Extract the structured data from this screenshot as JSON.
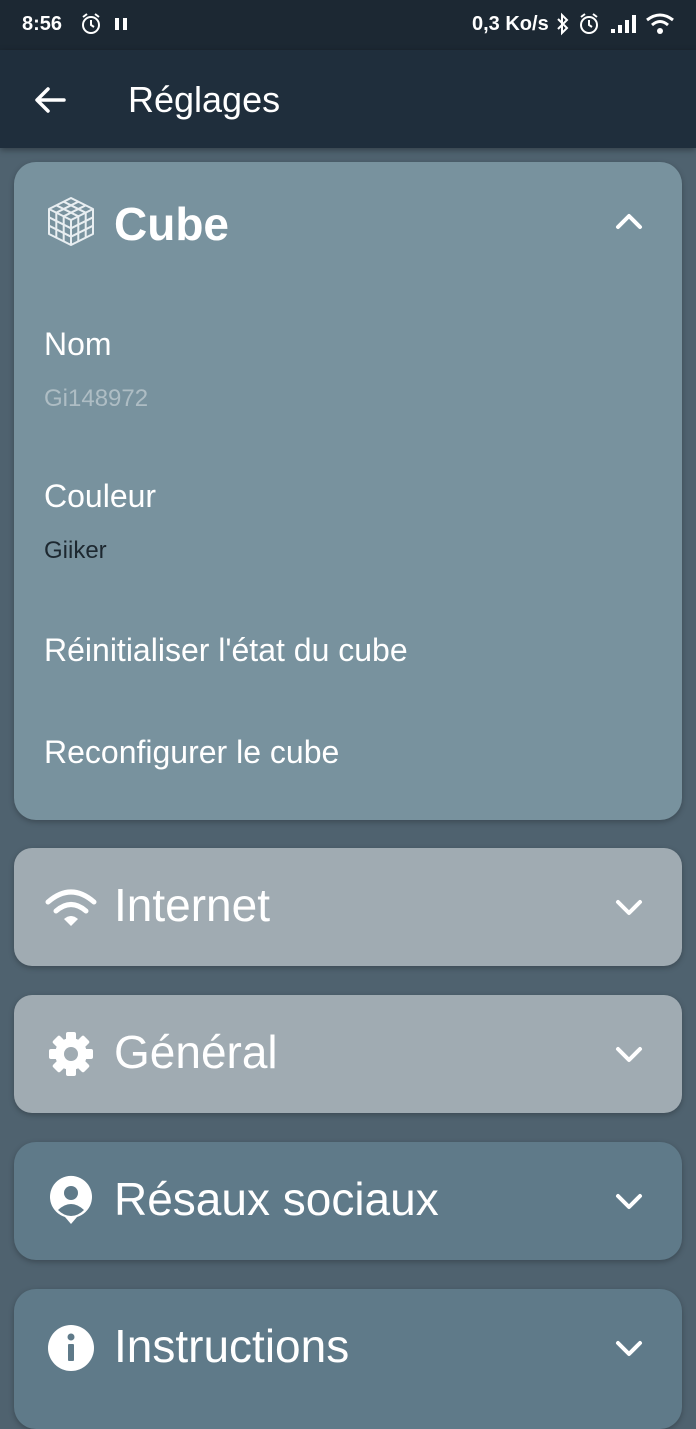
{
  "status_bar": {
    "time": "8:56",
    "speed": "0,3 Ko/s",
    "icons": [
      "alarm-icon",
      "pause-icon",
      "bluetooth-icon",
      "alarm-icon",
      "signal-icon",
      "wifi-icon"
    ]
  },
  "app_bar": {
    "title": "Réglages",
    "back_icon": "arrow-left-icon"
  },
  "sections": {
    "cube": {
      "title": "Cube",
      "icon": "cube-icon",
      "expanded": true,
      "settings": {
        "name": {
          "label": "Nom",
          "value": "Gi148972"
        },
        "color": {
          "label": "Couleur",
          "value": "Giiker"
        },
        "reset": {
          "label": "Réinitialiser l'état du cube"
        },
        "reconfigure": {
          "label": "Reconfigurer le cube"
        }
      }
    },
    "internet": {
      "title": "Internet",
      "icon": "wifi-icon",
      "expanded": false
    },
    "general": {
      "title": "Général",
      "icon": "gear-icon",
      "expanded": false
    },
    "social": {
      "title": "Résaux sociaux",
      "icon": "account-icon",
      "expanded": false
    },
    "instructions": {
      "title": "Instructions",
      "icon": "info-icon",
      "expanded": false
    }
  },
  "colors": {
    "background": "#4f626f",
    "app_bar": "#1f2e3c",
    "status_bar": "#1c2833",
    "progress_line": "#43c51a",
    "cube_card": "#78929e",
    "disabled_card": "#a0abb2",
    "card": "#5f7a89"
  }
}
